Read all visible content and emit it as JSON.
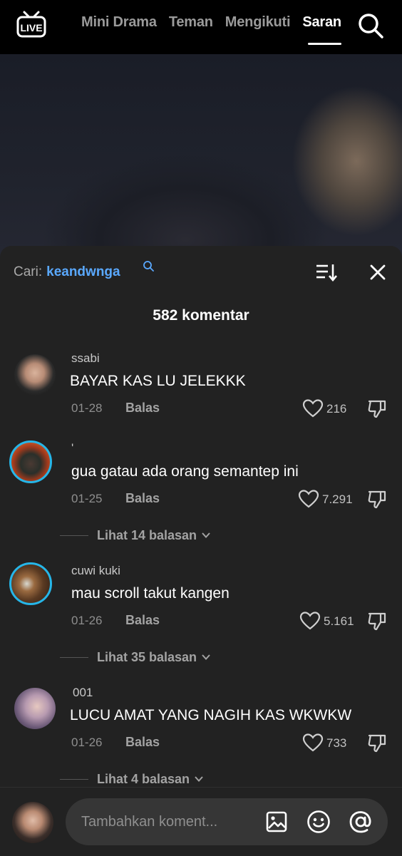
{
  "top_nav": {
    "live_label": "LIVE",
    "tabs": [
      {
        "label": "Mini Drama"
      },
      {
        "label": "Teman"
      },
      {
        "label": "Mengikuti"
      },
      {
        "label": "Saran"
      }
    ],
    "active_tab": "Saran",
    "search_icon": "search-icon"
  },
  "comments_panel": {
    "search_prefix": "Cari:",
    "search_keyword": "keandwnga",
    "count_label": "582 komentar",
    "accent_color": "#5aa9ff",
    "comments": [
      {
        "username": "ssabi",
        "text": "BAYAR KAS LU JELEKKK",
        "date": "01-28",
        "reply_label": "Balas",
        "likes": "216"
      },
      {
        "username": "'",
        "text": "gua gatau ada orang semantep ini",
        "date": "01-25",
        "reply_label": "Balas",
        "likes": "7.291",
        "view_replies": "Lihat 14 balasan"
      },
      {
        "username": "cuwi kuki",
        "text": "mau scroll takut kangen",
        "date": "01-26",
        "reply_label": "Balas",
        "likes": "5.161",
        "view_replies": "Lihat 35 balasan"
      },
      {
        "username": "001",
        "text": "LUCU AMAT YANG NAGIH KAS WKWKW",
        "date": "01-26",
        "reply_label": "Balas",
        "likes": "733",
        "view_replies": "Lihat 4 balasan"
      }
    ]
  },
  "composer": {
    "placeholder": "Tambahkan koment...",
    "icons": [
      "image-icon",
      "emoji-icon",
      "mention-icon"
    ]
  }
}
